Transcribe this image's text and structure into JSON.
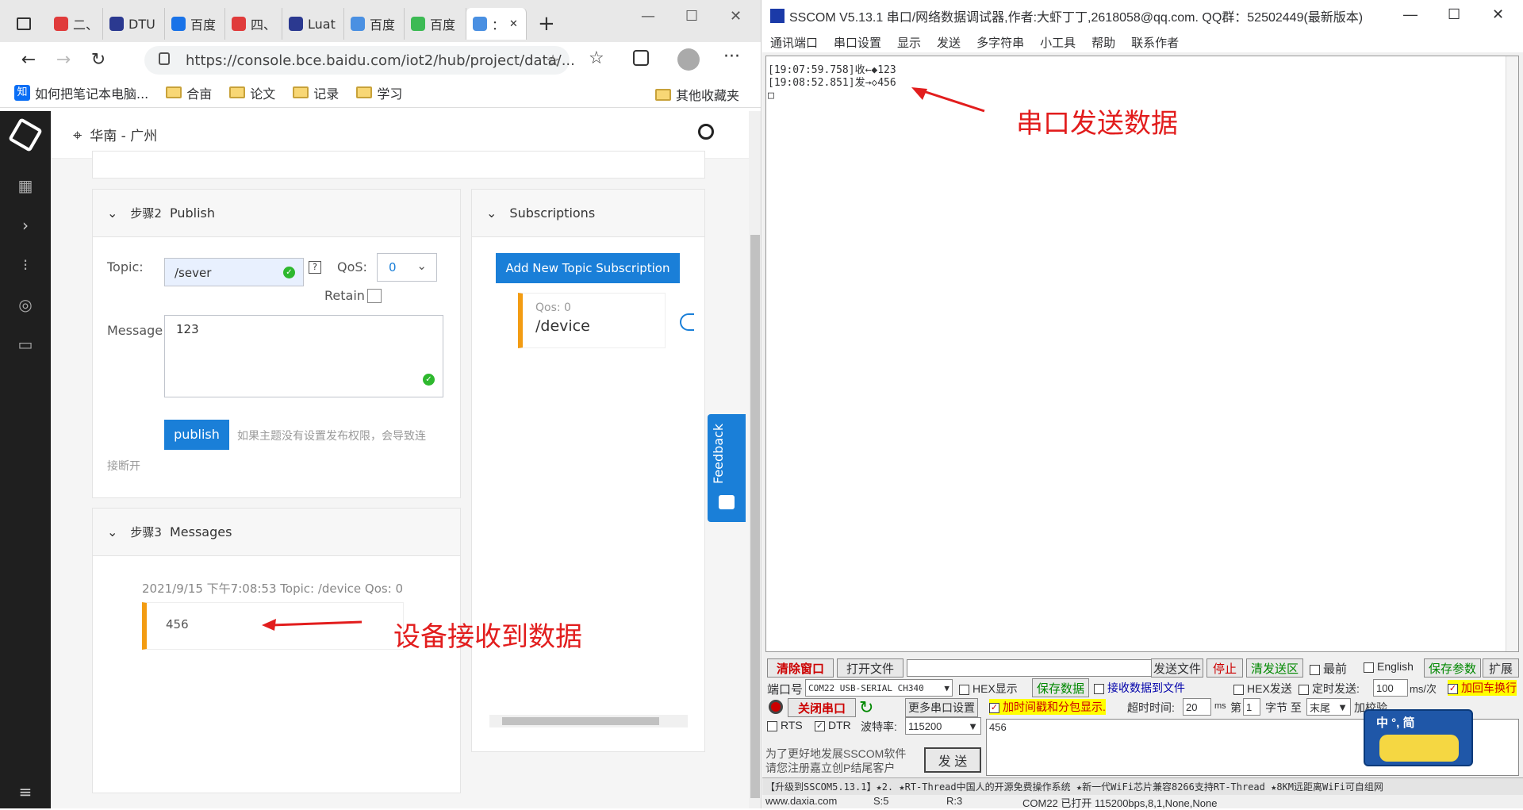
{
  "browser": {
    "tabs": [
      {
        "label": "二、",
        "color": "#e03b3b"
      },
      {
        "label": "DTU",
        "color": "#2b3990"
      },
      {
        "label": "百度",
        "color": "#1a73e8"
      },
      {
        "label": "四、",
        "color": "#e03b3b"
      },
      {
        "label": "Luat",
        "color": "#2b3990"
      },
      {
        "label": "百度",
        "color": "#4a90e2"
      },
      {
        "label": "百度",
        "color": "#3cba54"
      },
      {
        "label": "：",
        "color": "#4a90e2"
      }
    ],
    "url": "https://console.bce.baidu.com/iot2/hub/project/data/...",
    "bookmarks": [
      {
        "label": "如何把笔记本电脑...",
        "icon": "zhihu-icon"
      },
      {
        "label": "合亩",
        "icon": "folder-icon"
      },
      {
        "label": "论文",
        "icon": "folder-icon"
      },
      {
        "label": "记录",
        "icon": "folder-icon"
      },
      {
        "label": "学习",
        "icon": "folder-icon"
      }
    ],
    "other_bookmarks": "其他收藏夹"
  },
  "console": {
    "region": "华南 - 广州",
    "step2": {
      "title": "步骤2",
      "name": "Publish",
      "topic_label": "Topic:",
      "topic_value": "/sever",
      "qos_label": "QoS:",
      "qos_value": "0",
      "retain_label": "Retain",
      "message_label": "Message:",
      "message_value": "123",
      "publish_button": "publish",
      "hint": "如果主题没有设置发布权限，会导致连",
      "hint2": "接断开"
    },
    "subscriptions": {
      "title": "Subscriptions",
      "add_button": "Add New Topic Subscription",
      "item_qos": "Qos: 0",
      "item_topic": "/device"
    },
    "step3": {
      "title": "步骤3",
      "name": "Messages",
      "meta": "2021/9/15 下午7:08:53   Topic: /device   Qos: 0",
      "message": "456"
    },
    "feedback": "Feedback",
    "annotation": "设备接收到数据"
  },
  "sscom": {
    "title": "SSCOM V5.13.1 串口/网络数据调试器,作者:大虾丁丁,2618058@qq.com. QQ群：52502449(最新版本)",
    "menu": [
      "通讯端口",
      "串口设置",
      "显示",
      "发送",
      "多字符串",
      "小工具",
      "帮助",
      "联系作者"
    ],
    "log": [
      "[19:07:59.758]收←◆123",
      "[19:08:52.851]发→◇456",
      "□"
    ],
    "annotation": "串口发送数据",
    "row1": {
      "clear": "清除窗口",
      "open_file": "打开文件",
      "send_file": "发送文件",
      "stop": "停止",
      "clear_send": "清发送区",
      "topmost": "最前",
      "english": "English",
      "save_params": "保存参数",
      "expand": "扩展"
    },
    "row2": {
      "port_label": "端口号",
      "port_value": "COM22 USB-SERIAL CH340",
      "hex_display": "HEX显示",
      "save_data": "保存数据",
      "recv_to_file": "接收数据到文件",
      "hex_send": "HEX发送",
      "timed_send": "定时发送:",
      "interval": "100",
      "interval_unit": "ms/次",
      "crlf": "加回车换行"
    },
    "row3": {
      "close_port": "关闭串口",
      "more_settings": "更多串口设置",
      "timestamp": "加时间戳和分包显示.",
      "timeout_label": "超时时间:",
      "timeout": "20",
      "timeout_unit": "ms",
      "nth": "第",
      "nth_value": "1",
      "byte_to": "字节 至",
      "tail": "末尾",
      "checksum": "加校验"
    },
    "row4": {
      "rts": "RTS",
      "dtr": "DTR",
      "baud_label": "波特率:",
      "baud": "115200"
    },
    "send_input": "456",
    "promo1": "为了更好地发展SSCOM软件",
    "promo2": "请您注册嘉立创P结尾客户",
    "send_button": "发  送",
    "ime": "中 °, 简",
    "ticker": "【升级到SSCOM5.13.1】★2. ★RT-Thread中国人的开源免费操作系统 ★新一代WiFi芯片兼容8266支持RT-Thread ★8KM远距离WiFi可自组网",
    "status": [
      "www.daxia.com",
      "S:5",
      "R:3",
      "COM22 已打开  115200bps,8,1,None,None"
    ]
  }
}
